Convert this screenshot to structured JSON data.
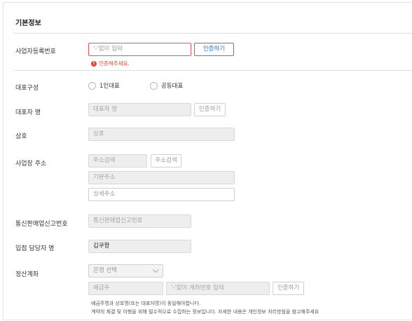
{
  "section": {
    "title": "기본정보"
  },
  "business_number": {
    "label": "사업자등록번호",
    "placeholder": "'-'없이 입력",
    "verify_button": "인증하기",
    "error": "인증해주세요."
  },
  "representative_type": {
    "label": "대표구성",
    "options": [
      "1인대표",
      "공동대표"
    ]
  },
  "representative_name": {
    "label": "대표자 명",
    "placeholder": "대표자 명",
    "verify_button": "인증하기"
  },
  "company_name": {
    "label": "상호",
    "placeholder": "상호"
  },
  "address": {
    "label": "사업장 주소",
    "search_placeholder": "주소검색",
    "search_button": "주소검색",
    "basic_placeholder": "기본주소",
    "detail_placeholder": "상세주소"
  },
  "mail_order": {
    "label": "통신판매업신고번호",
    "placeholder": "통신판매업신고번호"
  },
  "manager": {
    "label": "입점 담당자 명",
    "value": "김쿠팡"
  },
  "settlement": {
    "label": "정산계좌",
    "bank_select": "은행 선택",
    "holder_placeholder": "예금주",
    "account_placeholder": "'-'없이 계좌번호 입력",
    "verify_button": "인증하기",
    "note_1": "예금주명과 상호명(또는 대표자명)이 동일해야합니다.",
    "note_2": "계약의 체결 및 이행을 위해 필수적으로 수집하는 정보입니다. 자세한 내용은 개인정보 처리방침을 참고해주세요"
  },
  "colors": {
    "accent": "#3d7fe0",
    "error": "#e04a3f"
  },
  "icons": {
    "error": "exclamation-circle-icon",
    "select": "chevron-down-icon"
  }
}
